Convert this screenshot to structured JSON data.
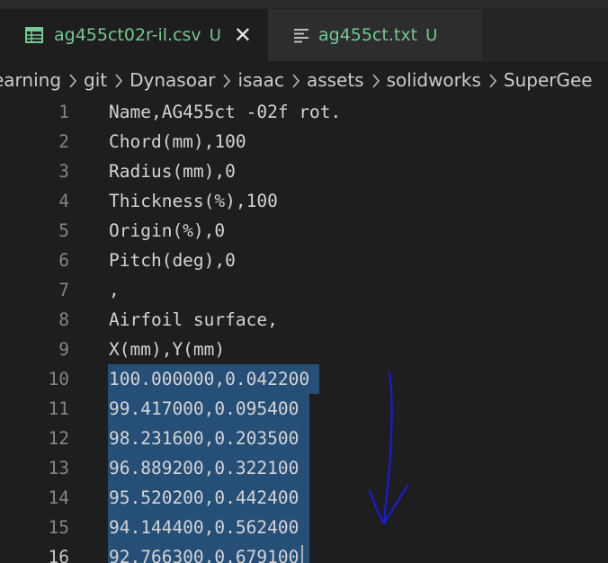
{
  "tabs": [
    {
      "label": "ag455ct02r-il.csv",
      "status": "U",
      "close": "✕",
      "icon": "table-icon",
      "active": true
    },
    {
      "label": "ag455ct.txt",
      "status": "U",
      "icon": "text-lines-icon",
      "active": false
    }
  ],
  "breadcrumb": [
    "earning",
    "git",
    "Dynasoar",
    "isaac",
    "assets",
    "solidworks",
    "SuperGee"
  ],
  "lines": [
    {
      "num": "1",
      "text": "Name,AG455ct -02f rot."
    },
    {
      "num": "2",
      "text": "Chord(mm),100"
    },
    {
      "num": "3",
      "text": "Radius(mm),0"
    },
    {
      "num": "4",
      "text": "Thickness(%),100"
    },
    {
      "num": "5",
      "text": "Origin(%),0"
    },
    {
      "num": "6",
      "text": "Pitch(deg),0"
    },
    {
      "num": "7",
      "text": ","
    },
    {
      "num": "8",
      "text": "Airfoil surface,"
    },
    {
      "num": "9",
      "text": "X(mm),Y(mm)"
    },
    {
      "num": "10",
      "text": "100.000000,0.042200"
    },
    {
      "num": "11",
      "text": "99.417000,0.095400"
    },
    {
      "num": "12",
      "text": "98.231600,0.203500"
    },
    {
      "num": "13",
      "text": "96.889200,0.322100"
    },
    {
      "num": "14",
      "text": "95.520200,0.442400"
    },
    {
      "num": "15",
      "text": "94.144400,0.562400"
    },
    {
      "num": "16",
      "text": "92.766300,0.679100"
    }
  ],
  "colors": {
    "added_file": "#73c991",
    "selection": "#264f78",
    "annotation_arrow": "#1a1adb"
  }
}
